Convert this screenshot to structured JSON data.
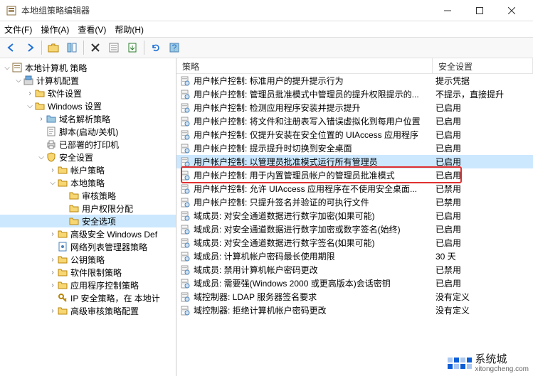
{
  "window": {
    "title": "本地组策略编辑器"
  },
  "menu": {
    "file": "文件(F)",
    "action": "操作(A)",
    "view": "查看(V)",
    "help": "帮助(H)"
  },
  "tree": {
    "root": "本地计算机 策略",
    "computer_config": "计算机配置",
    "software": "软件设置",
    "windows_settings": "Windows 设置",
    "dns_policy": "域名解析策略",
    "scripts": "脚本(启动/关机)",
    "printers": "已部署的打印机",
    "security": "安全设置",
    "account_policy": "帐户策略",
    "local_policy": "本地策略",
    "audit_policy": "审核策略",
    "user_rights": "用户权限分配",
    "security_options": "安全选项",
    "adv_windows_def": "高级安全 Windows Def",
    "network_list": "网络列表管理器策略",
    "public_key": "公钥策略",
    "software_restrict": "软件限制策略",
    "app_control": "应用程序控制策略",
    "ip_sec": "IP 安全策略，在 本地计",
    "adv_audit": "高级审核策略配置"
  },
  "list": {
    "col_policy": "策略",
    "col_setting": "安全设置",
    "rows": [
      {
        "p": "用户帐户控制: 标准用户的提升提示行为",
        "s": "提示凭据"
      },
      {
        "p": "用户帐户控制: 管理员批准模式中管理员的提升权限提示的...",
        "s": "不提示，直接提升"
      },
      {
        "p": "用户帐户控制: 检测应用程序安装并提示提升",
        "s": "已启用"
      },
      {
        "p": "用户帐户控制: 将文件和注册表写入错误虚拟化到每用户位置",
        "s": "已启用"
      },
      {
        "p": "用户帐户控制: 仅提升安装在安全位置的 UIAccess 应用程序",
        "s": "已启用"
      },
      {
        "p": "用户帐户控制: 提示提升时切换到安全桌面",
        "s": "已启用"
      },
      {
        "p": "用户帐户控制: 以管理员批准模式运行所有管理员",
        "s": "已启用",
        "sel": true
      },
      {
        "p": "用户帐户控制: 用于内置管理员帐户的管理员批准模式",
        "s": "已启用"
      },
      {
        "p": "用户帐户控制: 允许 UIAccess 应用程序在不使用安全桌面...",
        "s": "已禁用"
      },
      {
        "p": "用户帐户控制: 只提升签名并验证的可执行文件",
        "s": "已禁用"
      },
      {
        "p": "域成员: 对安全通道数据进行数字加密(如果可能)",
        "s": "已启用"
      },
      {
        "p": "域成员: 对安全通道数据进行数字加密或数字签名(始终)",
        "s": "已启用"
      },
      {
        "p": "域成员: 对安全通道数据进行数字签名(如果可能)",
        "s": "已启用"
      },
      {
        "p": "域成员: 计算机帐户密码最长使用期限",
        "s": "30 天"
      },
      {
        "p": "域成员: 禁用计算机帐户密码更改",
        "s": "已禁用"
      },
      {
        "p": "域成员: 需要强(Windows 2000 或更高版本)会话密钥",
        "s": "已启用"
      },
      {
        "p": "域控制器: LDAP 服务器签名要求",
        "s": "没有定义"
      },
      {
        "p": "域控制器: 拒绝计算机帐户密码更改",
        "s": "没有定义"
      }
    ]
  },
  "watermark": {
    "cn": "系统城",
    "en": "xitongcheng.com"
  }
}
